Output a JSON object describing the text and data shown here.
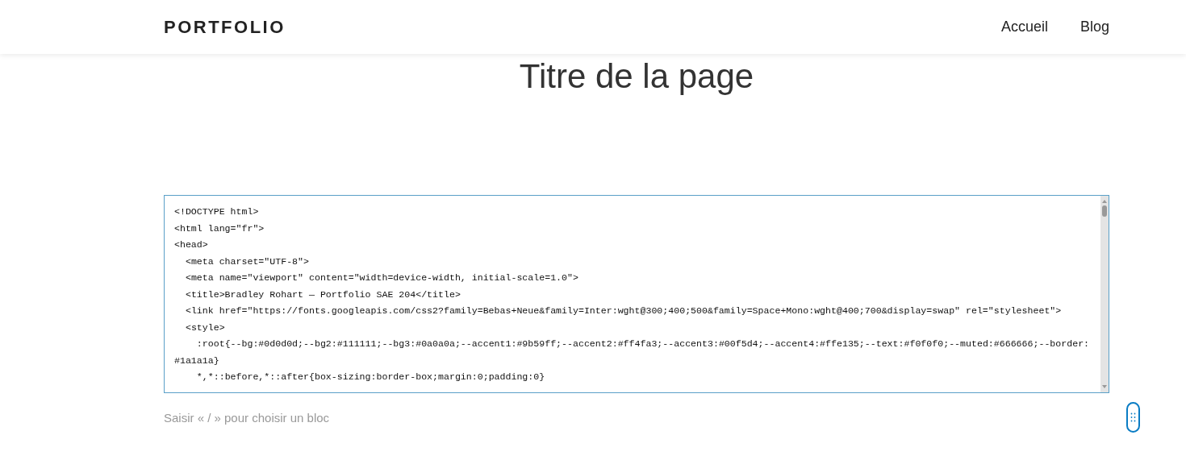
{
  "header": {
    "logo": "PORTFOLIO",
    "nav": [
      {
        "label": "Accueil"
      },
      {
        "label": "Blog"
      }
    ]
  },
  "page_title": "Titre de la page",
  "code_block": {
    "lines": [
      "<!DOCTYPE html>",
      "<html lang=\"fr\">",
      "<head>",
      "  <meta charset=\"UTF-8\">",
      "  <meta name=\"viewport\" content=\"width=device-width, initial-scale=1.0\">",
      "  <title>Bradley Rohart — Portfolio SAE 204</title>",
      "  <link href=\"https://fonts.googleapis.com/css2?family=Bebas+Neue&family=Inter:wght@300;400;500&family=Space+Mono:wght@400;700&display=swap\" rel=\"stylesheet\">",
      "  <style>",
      "    :root{--bg:#0d0d0d;--bg2:#111111;--bg3:#0a0a0a;--accent1:#9b59ff;--accent2:#ff4fa3;--accent3:#00f5d4;--accent4:#ffe135;--text:#f0f0f0;--muted:#666666;--border:#1a1a1a}",
      "    *,*::before,*::after{box-sizing:border-box;margin:0;padding:0}"
    ]
  },
  "block_prompt": {
    "placeholder": "Saisir « / » pour choisir un bloc"
  }
}
